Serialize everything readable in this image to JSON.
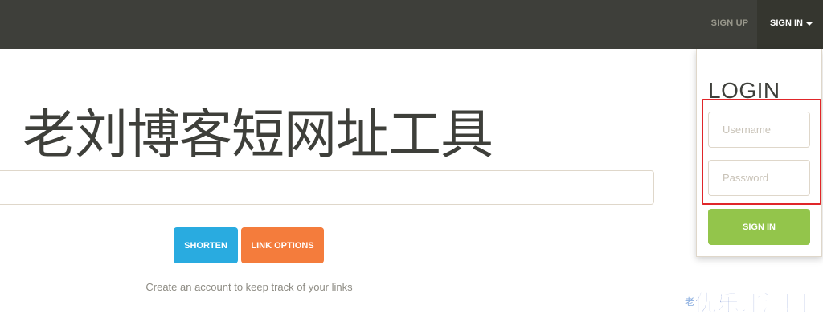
{
  "navbar": {
    "signup_label": "SIGN UP",
    "signin_label": "SIGN IN"
  },
  "hero": {
    "title": "老刘博客短网址工具"
  },
  "url_input": {
    "value": "",
    "placeholder": ""
  },
  "actions": {
    "shorten_label": "SHORTEN",
    "link_options_label": "LINK OPTIONS"
  },
  "hint": "Create an account to keep track of your links",
  "login": {
    "title": "LOGIN",
    "username_placeholder": "Username",
    "password_placeholder": "Password",
    "submit_label": "SIGN IN"
  },
  "watermark": {
    "text": "优乐评测网",
    "small_text": "老"
  },
  "colors": {
    "navbar": "#3e3f3a",
    "shorten": "#29abe0",
    "link_options": "#f47c3c",
    "signin_button": "#93c54b",
    "highlight": "#e0262a"
  }
}
